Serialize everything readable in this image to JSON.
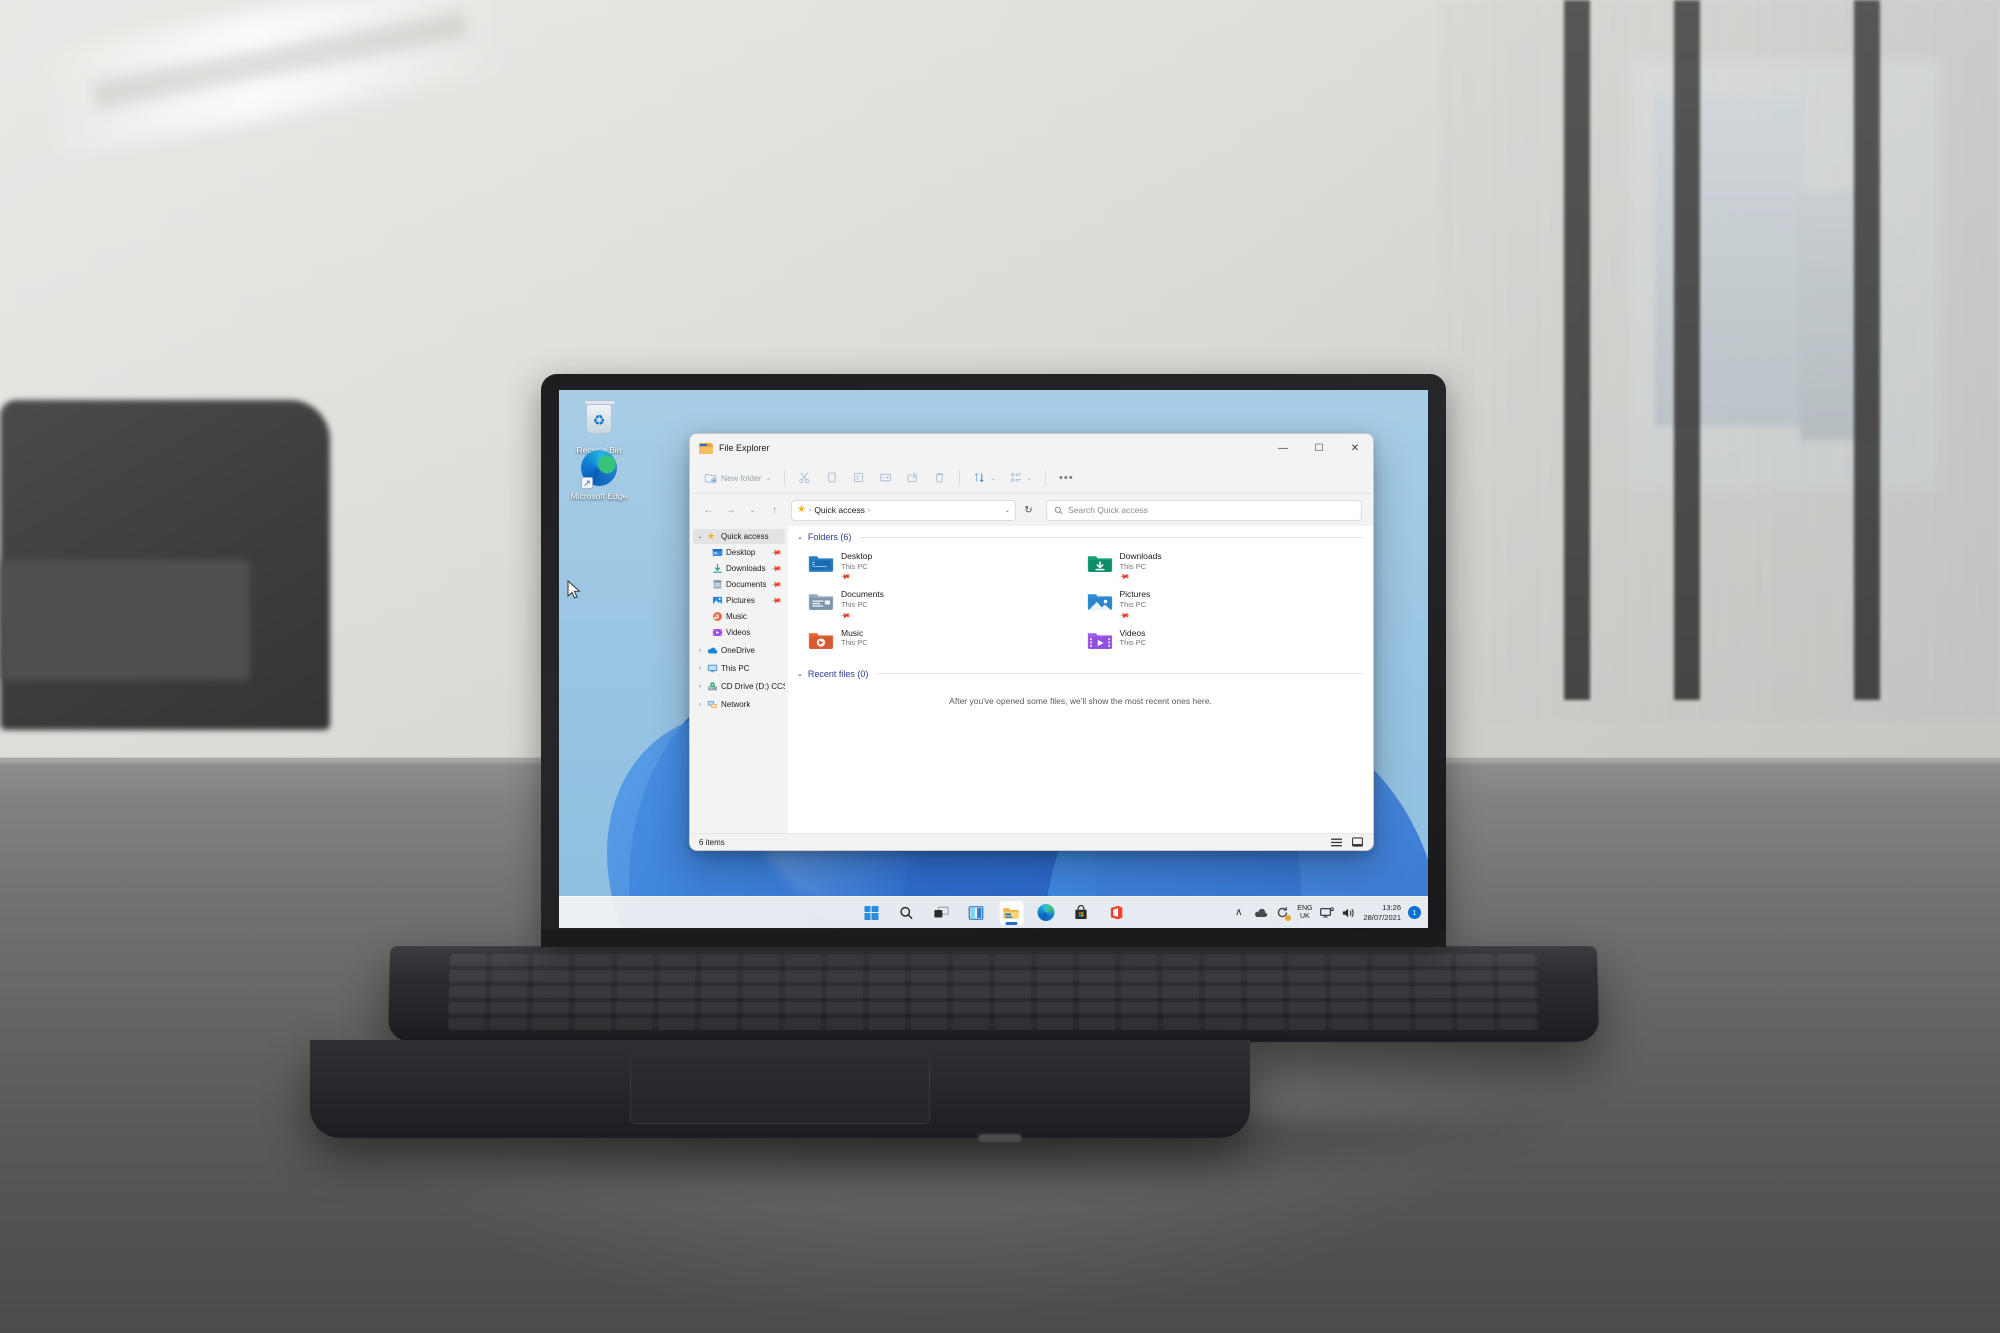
{
  "scene": {
    "description": "Laptop on office desk showing Windows 11 desktop with File Explorer open"
  },
  "desktop": {
    "icons": [
      {
        "name": "Recycle Bin",
        "icon": "recycle-bin-icon"
      },
      {
        "name": "Microsoft Edge",
        "icon": "microsoft-edge-icon"
      }
    ]
  },
  "file_explorer": {
    "title": "File Explorer",
    "title_icon": "folder-icon",
    "window_controls": {
      "minimize": "—",
      "maximize": "☐",
      "close": "✕"
    },
    "toolbar": {
      "new_folder_label": "New folder",
      "new_folder_caret": "⌄",
      "items": [
        {
          "name": "cut",
          "icon": "scissors-icon"
        },
        {
          "name": "copy",
          "icon": "copy-icon"
        },
        {
          "name": "paste",
          "icon": "paste-icon"
        },
        {
          "name": "rename",
          "icon": "rename-icon"
        },
        {
          "name": "share",
          "icon": "share-icon"
        },
        {
          "name": "delete",
          "icon": "trash-icon"
        }
      ],
      "sort_label": "Sort",
      "view_label": "View",
      "more_label": "•••"
    },
    "address_bar": {
      "back": "←",
      "forward": "→",
      "recent": "⌄",
      "up": "↑",
      "breadcrumb_icon": "star-icon",
      "breadcrumb": "Quick access",
      "breadcrumb_trailing_sep": "›",
      "breadcrumb_caret": "⌄",
      "refresh": "↻"
    },
    "search": {
      "placeholder": "Search Quick access",
      "icon": "search-icon"
    },
    "sidebar": {
      "items": [
        {
          "label": "Quick access",
          "icon": "star-icon",
          "expander": "⌄",
          "indent": false,
          "selected": true,
          "pinned": false
        },
        {
          "label": "Desktop",
          "icon": "desktop-icon",
          "expander": "",
          "indent": true,
          "selected": false,
          "pinned": true
        },
        {
          "label": "Downloads",
          "icon": "downloads-icon",
          "expander": "",
          "indent": true,
          "selected": false,
          "pinned": true
        },
        {
          "label": "Documents",
          "icon": "documents-icon",
          "expander": "",
          "indent": true,
          "selected": false,
          "pinned": true
        },
        {
          "label": "Pictures",
          "icon": "pictures-icon",
          "expander": "",
          "indent": true,
          "selected": false,
          "pinned": true
        },
        {
          "label": "Music",
          "icon": "music-icon",
          "expander": "",
          "indent": true,
          "selected": false,
          "pinned": false
        },
        {
          "label": "Videos",
          "icon": "videos-icon",
          "expander": "",
          "indent": true,
          "selected": false,
          "pinned": false
        },
        {
          "label": "OneDrive",
          "icon": "onedrive-icon",
          "expander": "›",
          "indent": false,
          "selected": false,
          "pinned": false
        },
        {
          "label": "This PC",
          "icon": "this-pc-icon",
          "expander": "›",
          "indent": false,
          "selected": false,
          "pinned": false
        },
        {
          "label": "CD Drive (D:) CCSA_",
          "icon": "cd-drive-icon",
          "expander": "›",
          "indent": false,
          "selected": false,
          "pinned": false
        },
        {
          "label": "Network",
          "icon": "network-icon",
          "expander": "›",
          "indent": false,
          "selected": false,
          "pinned": false
        }
      ]
    },
    "content": {
      "folders_section": {
        "chevron": "⌄",
        "title": "Folders (6)"
      },
      "folders": [
        {
          "name": "Desktop",
          "location": "This PC",
          "icon": "folder-desktop-icon",
          "pinned": true
        },
        {
          "name": "Downloads",
          "location": "This PC",
          "icon": "folder-downloads-icon",
          "pinned": true
        },
        {
          "name": "Documents",
          "location": "This PC",
          "icon": "folder-documents-icon",
          "pinned": true
        },
        {
          "name": "Pictures",
          "location": "This PC",
          "icon": "folder-pictures-icon",
          "pinned": true
        },
        {
          "name": "Music",
          "location": "This PC",
          "icon": "folder-music-icon",
          "pinned": false
        },
        {
          "name": "Videos",
          "location": "This PC",
          "icon": "folder-videos-icon",
          "pinned": false
        }
      ],
      "recent_section": {
        "chevron": "⌄",
        "title": "Recent files (0)",
        "empty_message": "After you've opened some files, we'll show the most recent ones here."
      }
    },
    "status_bar": {
      "item_count": "6 items",
      "views": [
        {
          "name": "details-view",
          "icon": "details-view-icon"
        },
        {
          "name": "large-icons-view",
          "icon": "large-icons-view-icon"
        }
      ]
    }
  },
  "taskbar": {
    "buttons": [
      {
        "name": "start",
        "icon": "windows-logo-icon",
        "active": false
      },
      {
        "name": "search",
        "icon": "search-icon",
        "active": false
      },
      {
        "name": "task-view",
        "icon": "task-view-icon",
        "active": false
      },
      {
        "name": "widgets",
        "icon": "widgets-icon",
        "active": false
      },
      {
        "name": "file-explorer",
        "icon": "folder-icon",
        "active": true
      },
      {
        "name": "microsoft-edge",
        "icon": "microsoft-edge-icon",
        "active": false
      },
      {
        "name": "microsoft-store",
        "icon": "store-icon",
        "active": false
      },
      {
        "name": "microsoft-office",
        "icon": "office-icon",
        "active": false
      }
    ],
    "tray": {
      "overflow": "∧",
      "onedrive_icon": "cloud-icon",
      "update_icon": "sync-icon",
      "language": {
        "line1": "ENG",
        "line2": "UK"
      },
      "network_icon": "network-tray-icon",
      "volume_icon": "volume-icon",
      "time": "13:26",
      "date": "28/07/2021",
      "notification_count": "1"
    }
  },
  "colors": {
    "accent": "#0b6fd4",
    "section_heading": "#2b3a8f",
    "window_bg": "#f3f3f3",
    "content_bg": "#ffffff",
    "star": "#f2b01e"
  }
}
